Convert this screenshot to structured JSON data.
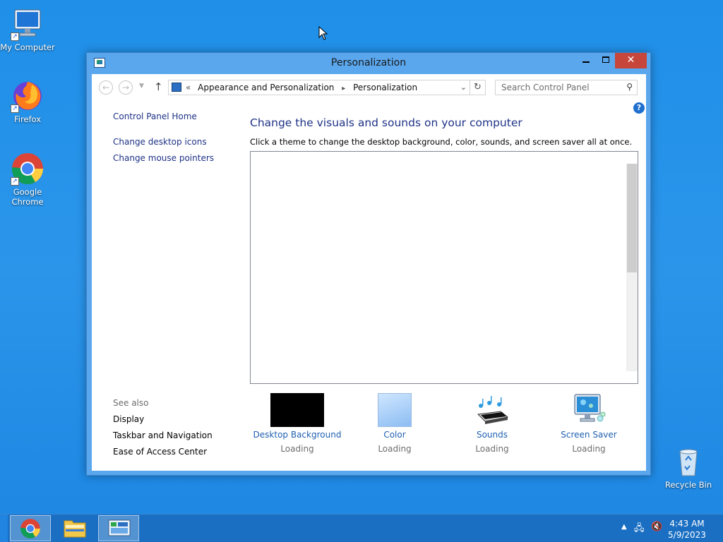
{
  "desktop": {
    "icons": [
      {
        "label": "My Computer"
      },
      {
        "label": "Firefox"
      },
      {
        "label": "Google Chrome"
      },
      {
        "label": "Recycle Bin"
      }
    ]
  },
  "window": {
    "title": "Personalization",
    "nav": {
      "breadcrumb_prefix": "«",
      "crumb1": "Appearance and Personalization",
      "crumb_sep": "▸",
      "crumb2": "Personalization",
      "search_placeholder": "Search Control Panel"
    },
    "left_pane": {
      "home": "Control Panel Home",
      "links": [
        "Change desktop icons",
        "Change mouse pointers"
      ],
      "see_also_title": "See also",
      "see_also": [
        "Display",
        "Taskbar and Navigation",
        "Ease of Access Center"
      ]
    },
    "main": {
      "heading": "Change the visuals and sounds on your computer",
      "subtext": "Click a theme to change the desktop background, color, sounds, and screen saver all at once.",
      "tiles": [
        {
          "label": "Desktop Background",
          "status": "Loading"
        },
        {
          "label": "Color",
          "status": "Loading"
        },
        {
          "label": "Sounds",
          "status": "Loading"
        },
        {
          "label": "Screen Saver",
          "status": "Loading"
        }
      ]
    },
    "help": "?"
  },
  "taskbar": {
    "clock": {
      "time": "4:43 AM",
      "date": "5/9/2023"
    },
    "tray_icons": [
      "show-hidden-icons-icon",
      "network-icon",
      "volume-muted-icon"
    ],
    "pinned": [
      "chrome-icon",
      "file-explorer-icon",
      "control-panel-icon"
    ]
  },
  "colors": {
    "desktop": "#2b95ea",
    "window_frame": "#5aa7ee",
    "close_button": "#c7463b",
    "link": "#1e3287",
    "tile_link": "#1e5fb0",
    "taskbar": "#1a6fc3"
  }
}
